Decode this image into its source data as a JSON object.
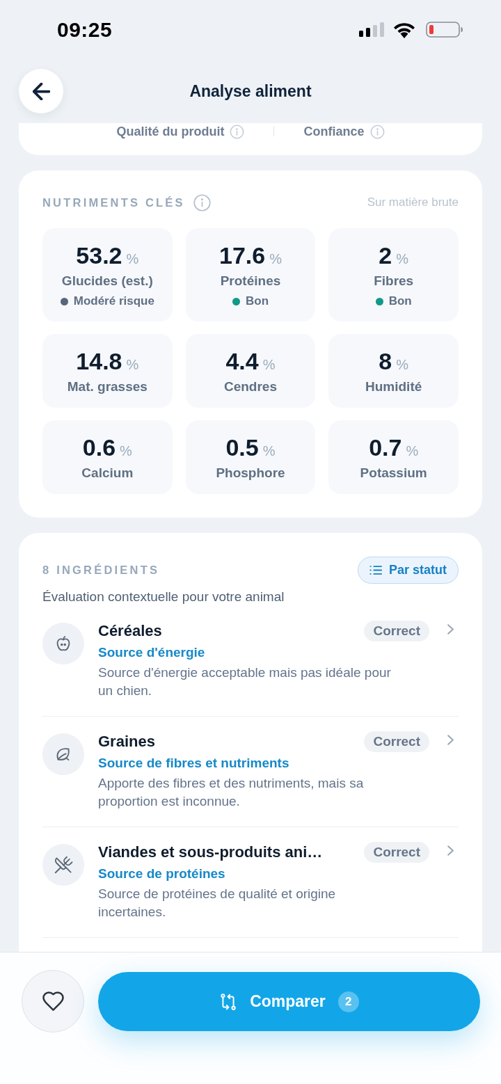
{
  "status_bar": {
    "time": "09:25"
  },
  "header": {
    "title": "Analyse aliment"
  },
  "summary": {
    "metrics": [
      {
        "label": "Qualité du produit"
      },
      {
        "label": "Confiance"
      }
    ]
  },
  "nutrients": {
    "title": "NUTRIMENTS CLÉS",
    "basis": "Sur matière brute",
    "items": [
      {
        "value": "53.2",
        "unit": "%",
        "label": "Glucides (est.)",
        "status": {
          "label": "Modéré risque",
          "color": "#56677c"
        }
      },
      {
        "value": "17.6",
        "unit": "%",
        "label": "Protéines",
        "status": {
          "label": "Bon",
          "color": "#11998a"
        }
      },
      {
        "value": "2",
        "unit": "%",
        "label": "Fibres",
        "status": {
          "label": "Bon",
          "color": "#11998a"
        }
      },
      {
        "value": "14.8",
        "unit": "%",
        "label": "Mat. grasses"
      },
      {
        "value": "4.4",
        "unit": "%",
        "label": "Cendres"
      },
      {
        "value": "8",
        "unit": "%",
        "label": "Humidité"
      },
      {
        "value": "0.6",
        "unit": "%",
        "label": "Calcium"
      },
      {
        "value": "0.5",
        "unit": "%",
        "label": "Phosphore"
      },
      {
        "value": "0.7",
        "unit": "%",
        "label": "Potassium"
      }
    ]
  },
  "ingredients": {
    "title": "8 INGRÉDIENTS",
    "sort_button": {
      "label": "Par statut"
    },
    "subtitle": "Évaluation contextuelle pour votre animal",
    "items": [
      {
        "kind": "cereal",
        "name": "Céréales",
        "role": "Source d'énergie",
        "description": "Source d'énergie acceptable mais pas idéale pour un chien.",
        "status": "Correct"
      },
      {
        "kind": "seed",
        "name": "Graines",
        "role": "Source de fibres et nutriments",
        "description": "Apporte des fibres et des nutriments, mais sa proportion est inconnue.",
        "status": "Correct"
      },
      {
        "kind": "meat",
        "name": "Viandes et sous-produits ani…",
        "role": "Source de protéines",
        "description": "Source de protéines de qualité et origine incertaines.",
        "status": "Correct"
      }
    ]
  },
  "actions": {
    "compare": {
      "label": "Comparer",
      "count": "2"
    }
  }
}
